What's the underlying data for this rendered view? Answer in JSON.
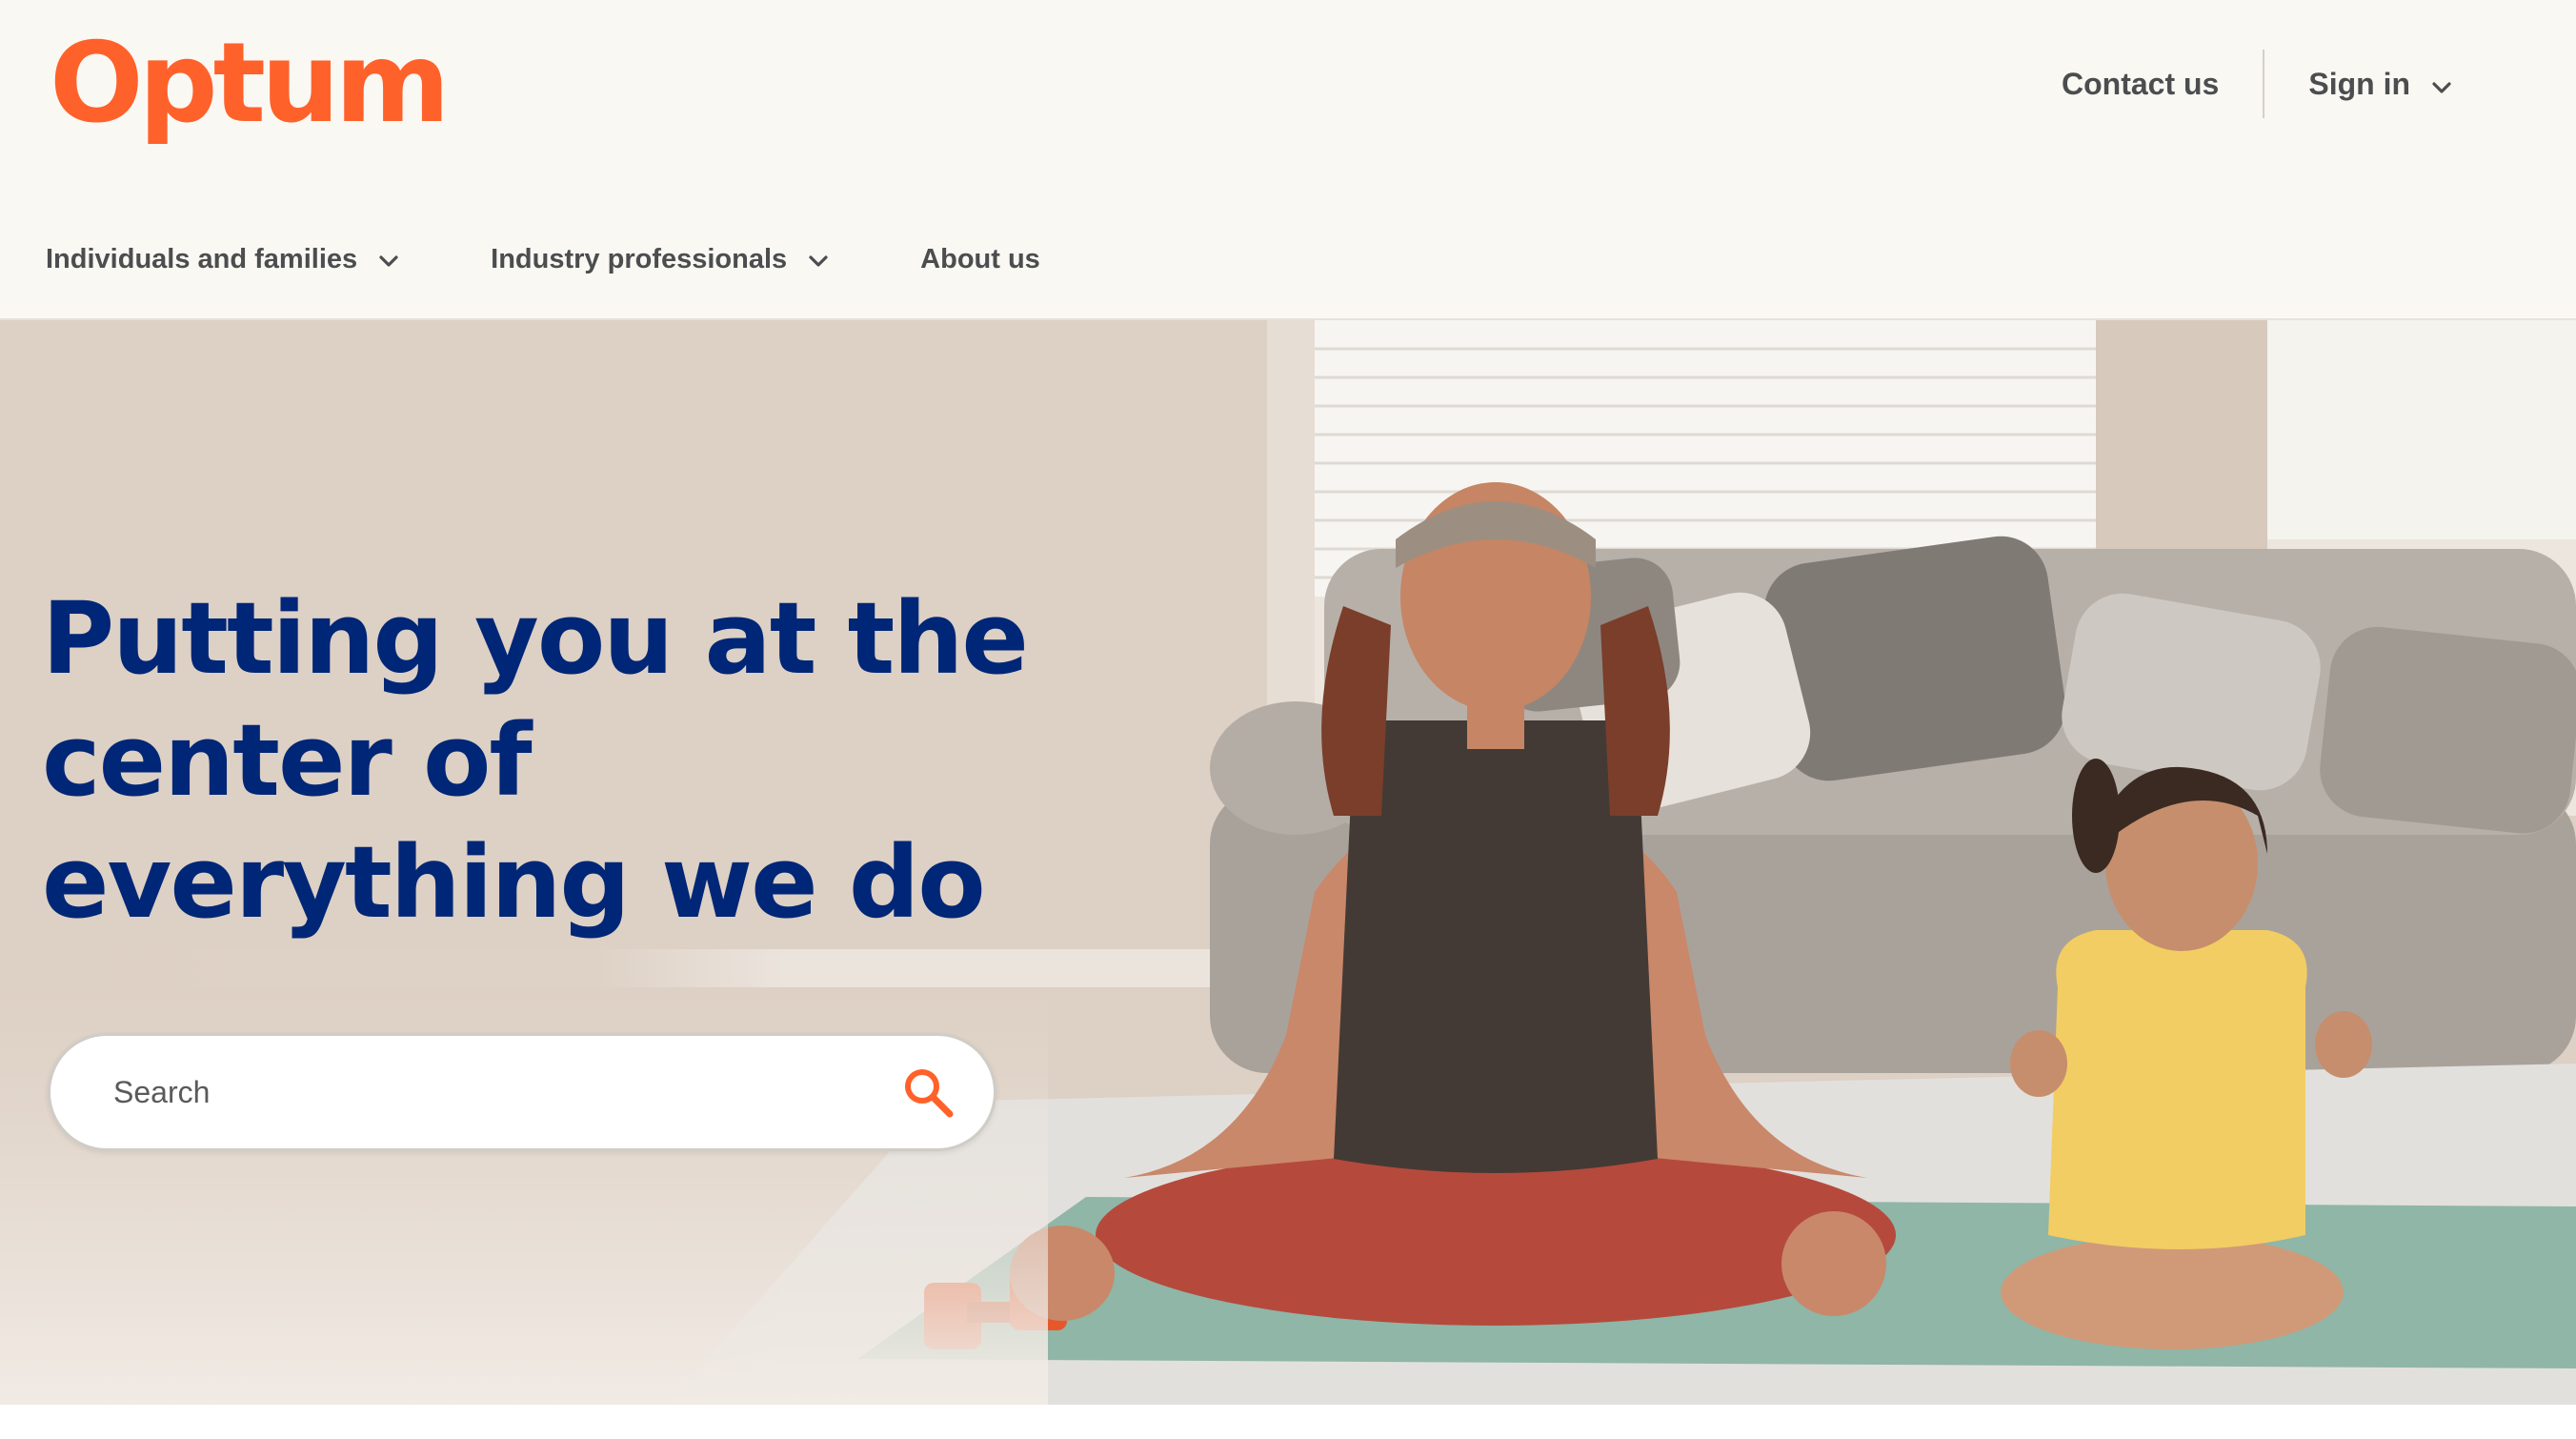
{
  "header": {
    "logo_text": "Optum",
    "utility_nav": {
      "contact_label": "Contact us",
      "sign_in_label": "Sign in"
    },
    "main_nav": [
      {
        "label": "Individuals and families",
        "has_dropdown": true,
        "icon": "chevron-down-icon"
      },
      {
        "label": "Industry professionals",
        "has_dropdown": true,
        "icon": "chevron-down-icon"
      },
      {
        "label": "About us",
        "has_dropdown": false
      }
    ]
  },
  "hero": {
    "headline": "Putting you at the center of everything we do",
    "search": {
      "placeholder": "Search",
      "value": "",
      "icon": "search-icon"
    }
  },
  "colors": {
    "brand_orange": "#ff612b",
    "headline_navy": "#002677",
    "nav_text": "#4b4d4f",
    "header_bg": "#faf8f3"
  }
}
